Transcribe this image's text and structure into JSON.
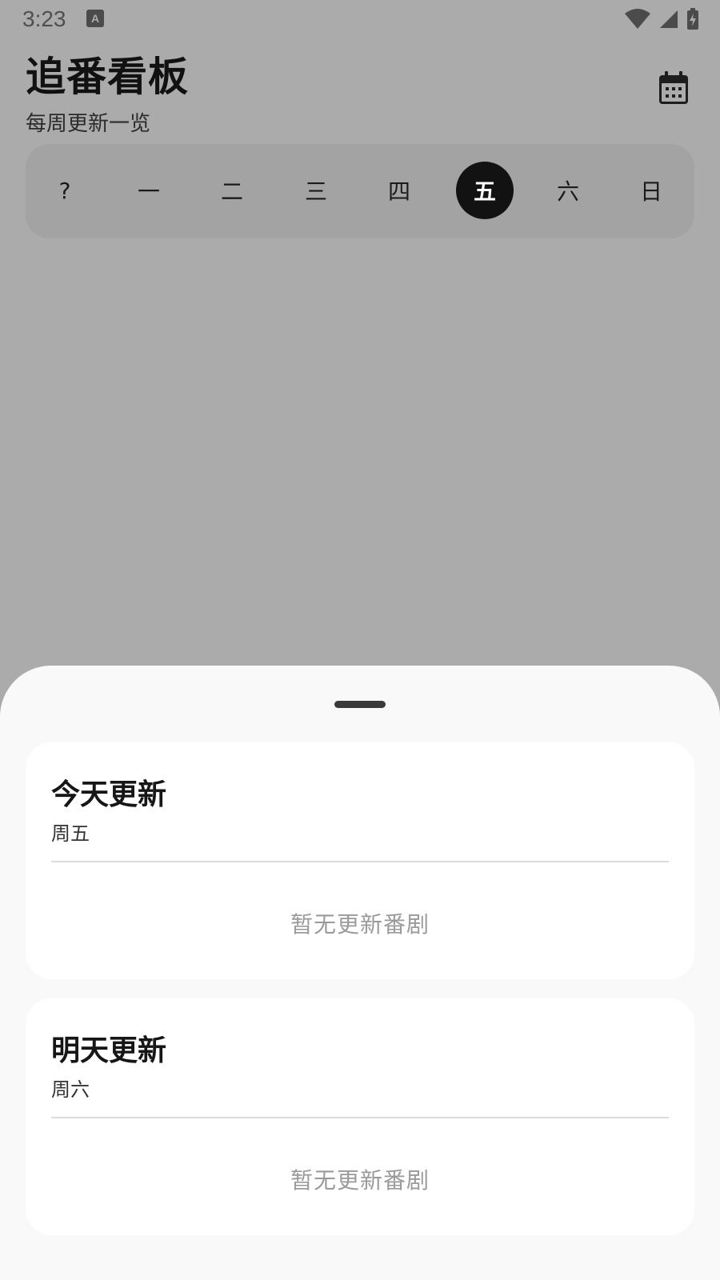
{
  "status_bar": {
    "time": "3:23",
    "notification_icon": "A",
    "icons": [
      "wifi-icon",
      "cell-signal-icon",
      "battery-charging-icon"
    ]
  },
  "header": {
    "title": "追番看板",
    "subtitle": "每周更新一览",
    "calendar_icon": "calendar-icon"
  },
  "weekdays": {
    "items": [
      "?",
      "一",
      "二",
      "三",
      "四",
      "五",
      "六",
      "日"
    ],
    "selected": "五"
  },
  "sheet": {
    "today": {
      "title": "今天更新",
      "day": "周五",
      "empty_text": "暂无更新番剧"
    },
    "tomorrow": {
      "title": "明天更新",
      "day": "周六",
      "empty_text": "暂无更新番剧"
    }
  },
  "colors": {
    "scrim": "#ababab",
    "selected_day": "#121212",
    "sheet_bg": "#f9f9f9",
    "card_bg": "#ffffff",
    "empty_text": "#9a9a9a"
  }
}
